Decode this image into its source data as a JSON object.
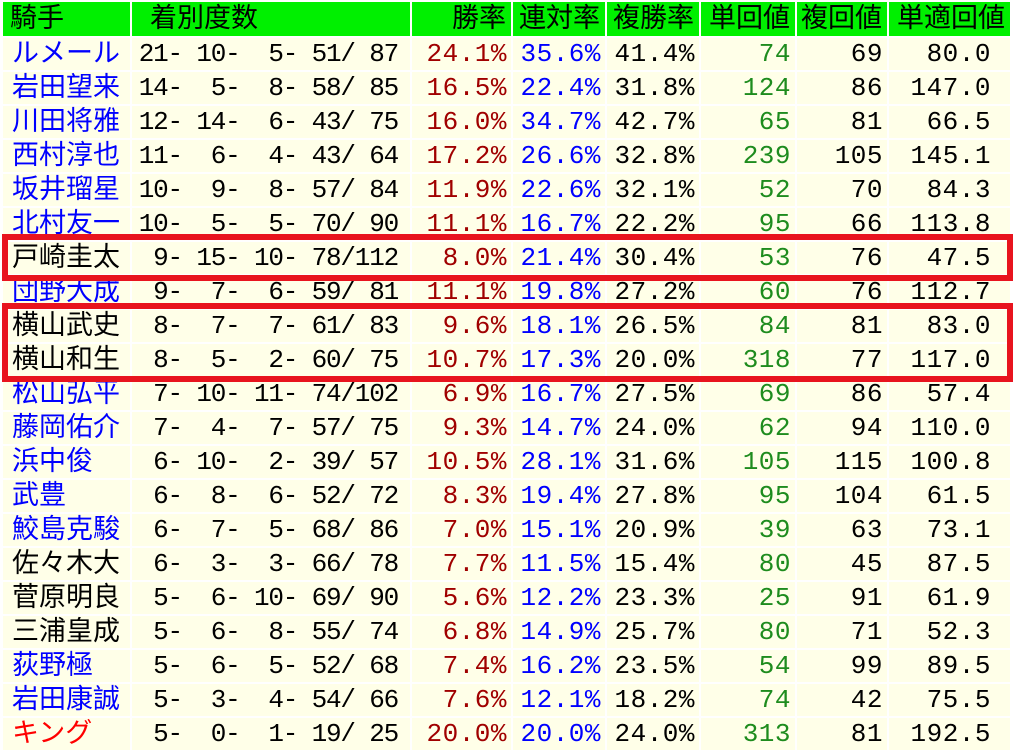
{
  "colors": {
    "header_bg": "#00F000",
    "header_text": "#000000",
    "cell_bg": "#FFFFE8",
    "record_text": "#000000",
    "win_rate_text": "#A00000",
    "quinella_rate_text": "#0000FF",
    "place_rate_text": "#000000",
    "win_return_text": "#1E8C1E",
    "place_return_text": "#000000",
    "adjusted_win_return_text": "#000000",
    "link_name": "#0000FF",
    "plain_name": "#000000",
    "red_name": "#FF0000",
    "highlight_box": "#E8141E"
  },
  "header": {
    "jockey": "騎手",
    "record": "着別度数",
    "win_rate": "勝率",
    "quinella_rate": "連対率",
    "place_rate": "複勝率",
    "win_return": "単回値",
    "place_return": "複回値",
    "adjusted_win_return": "単適回値"
  },
  "rows": [
    {
      "jockey": "ルメール",
      "name_color": "#0000FF",
      "record": "21- 10-  5- 51/ 87",
      "win_rate": "24.1%",
      "quinella_rate": "35.6%",
      "place_rate": "41.4%",
      "win_return": "74",
      "place_return": "69",
      "adjusted_win_return": "80.0"
    },
    {
      "jockey": "岩田望来",
      "name_color": "#0000FF",
      "record": "14-  5-  8- 58/ 85",
      "win_rate": "16.5%",
      "quinella_rate": "22.4%",
      "place_rate": "31.8%",
      "win_return": "124",
      "place_return": "86",
      "adjusted_win_return": "147.0"
    },
    {
      "jockey": "川田将雅",
      "name_color": "#0000FF",
      "record": "12- 14-  6- 43/ 75",
      "win_rate": "16.0%",
      "quinella_rate": "34.7%",
      "place_rate": "42.7%",
      "win_return": "65",
      "place_return": "81",
      "adjusted_win_return": "66.5"
    },
    {
      "jockey": "西村淳也",
      "name_color": "#0000FF",
      "record": "11-  6-  4- 43/ 64",
      "win_rate": "17.2%",
      "quinella_rate": "26.6%",
      "place_rate": "32.8%",
      "win_return": "239",
      "place_return": "105",
      "adjusted_win_return": "145.1"
    },
    {
      "jockey": "坂井瑠星",
      "name_color": "#0000FF",
      "record": "10-  9-  8- 57/ 84",
      "win_rate": "11.9%",
      "quinella_rate": "22.6%",
      "place_rate": "32.1%",
      "win_return": "52",
      "place_return": "70",
      "adjusted_win_return": "84.3"
    },
    {
      "jockey": "北村友一",
      "name_color": "#0000FF",
      "record": "10-  5-  5- 70/ 90",
      "win_rate": "11.1%",
      "quinella_rate": "16.7%",
      "place_rate": "22.2%",
      "win_return": "95",
      "place_return": "66",
      "adjusted_win_return": "113.8"
    },
    {
      "jockey": "戸崎圭太",
      "name_color": "#000000",
      "record": " 9- 15- 10- 78/112",
      "win_rate": "8.0%",
      "quinella_rate": "21.4%",
      "place_rate": "30.4%",
      "win_return": "53",
      "place_return": "76",
      "adjusted_win_return": "47.5"
    },
    {
      "jockey": "団野大成",
      "name_color": "#0000FF",
      "record": " 9-  7-  6- 59/ 81",
      "win_rate": "11.1%",
      "quinella_rate": "19.8%",
      "place_rate": "27.2%",
      "win_return": "60",
      "place_return": "76",
      "adjusted_win_return": "112.7"
    },
    {
      "jockey": "横山武史",
      "name_color": "#000000",
      "record": " 8-  7-  7- 61/ 83",
      "win_rate": "9.6%",
      "quinella_rate": "18.1%",
      "place_rate": "26.5%",
      "win_return": "84",
      "place_return": "81",
      "adjusted_win_return": "83.0"
    },
    {
      "jockey": "横山和生",
      "name_color": "#000000",
      "record": " 8-  5-  2- 60/ 75",
      "win_rate": "10.7%",
      "quinella_rate": "17.3%",
      "place_rate": "20.0%",
      "win_return": "318",
      "place_return": "77",
      "adjusted_win_return": "117.0"
    },
    {
      "jockey": "松山弘平",
      "name_color": "#0000FF",
      "record": " 7- 10- 11- 74/102",
      "win_rate": "6.9%",
      "quinella_rate": "16.7%",
      "place_rate": "27.5%",
      "win_return": "69",
      "place_return": "86",
      "adjusted_win_return": "57.4"
    },
    {
      "jockey": "藤岡佑介",
      "name_color": "#0000FF",
      "record": " 7-  4-  7- 57/ 75",
      "win_rate": "9.3%",
      "quinella_rate": "14.7%",
      "place_rate": "24.0%",
      "win_return": "62",
      "place_return": "94",
      "adjusted_win_return": "110.0"
    },
    {
      "jockey": "浜中俊",
      "name_color": "#0000FF",
      "record": " 6- 10-  2- 39/ 57",
      "win_rate": "10.5%",
      "quinella_rate": "28.1%",
      "place_rate": "31.6%",
      "win_return": "105",
      "place_return": "115",
      "adjusted_win_return": "100.8"
    },
    {
      "jockey": "武豊",
      "name_color": "#0000FF",
      "record": " 6-  8-  6- 52/ 72",
      "win_rate": "8.3%",
      "quinella_rate": "19.4%",
      "place_rate": "27.8%",
      "win_return": "95",
      "place_return": "104",
      "adjusted_win_return": "61.5"
    },
    {
      "jockey": "鮫島克駿",
      "name_color": "#0000FF",
      "record": " 6-  7-  5- 68/ 86",
      "win_rate": "7.0%",
      "quinella_rate": "15.1%",
      "place_rate": "20.9%",
      "win_return": "39",
      "place_return": "63",
      "adjusted_win_return": "73.1"
    },
    {
      "jockey": "佐々木大",
      "name_color": "#000000",
      "record": " 6-  3-  3- 66/ 78",
      "win_rate": "7.7%",
      "quinella_rate": "11.5%",
      "place_rate": "15.4%",
      "win_return": "80",
      "place_return": "45",
      "adjusted_win_return": "87.5"
    },
    {
      "jockey": "菅原明良",
      "name_color": "#000000",
      "record": " 5-  6- 10- 69/ 90",
      "win_rate": "5.6%",
      "quinella_rate": "12.2%",
      "place_rate": "23.3%",
      "win_return": "25",
      "place_return": "91",
      "adjusted_win_return": "61.9"
    },
    {
      "jockey": "三浦皇成",
      "name_color": "#000000",
      "record": " 5-  6-  8- 55/ 74",
      "win_rate": "6.8%",
      "quinella_rate": "14.9%",
      "place_rate": "25.7%",
      "win_return": "80",
      "place_return": "71",
      "adjusted_win_return": "52.3"
    },
    {
      "jockey": "荻野極",
      "name_color": "#0000FF",
      "record": " 5-  6-  5- 52/ 68",
      "win_rate": "7.4%",
      "quinella_rate": "16.2%",
      "place_rate": "23.5%",
      "win_return": "54",
      "place_return": "99",
      "adjusted_win_return": "89.5"
    },
    {
      "jockey": "岩田康誠",
      "name_color": "#0000FF",
      "record": " 5-  3-  4- 54/ 66",
      "win_rate": "7.6%",
      "quinella_rate": "12.1%",
      "place_rate": "18.2%",
      "win_return": "74",
      "place_return": "42",
      "adjusted_win_return": "75.5"
    },
    {
      "jockey": "キング",
      "name_color": "#FF0000",
      "record": " 5-  0-  1- 19/ 25",
      "win_rate": "20.0%",
      "quinella_rate": "20.0%",
      "place_rate": "24.0%",
      "win_return": "313",
      "place_return": "81",
      "adjusted_win_return": "192.5"
    }
  ]
}
